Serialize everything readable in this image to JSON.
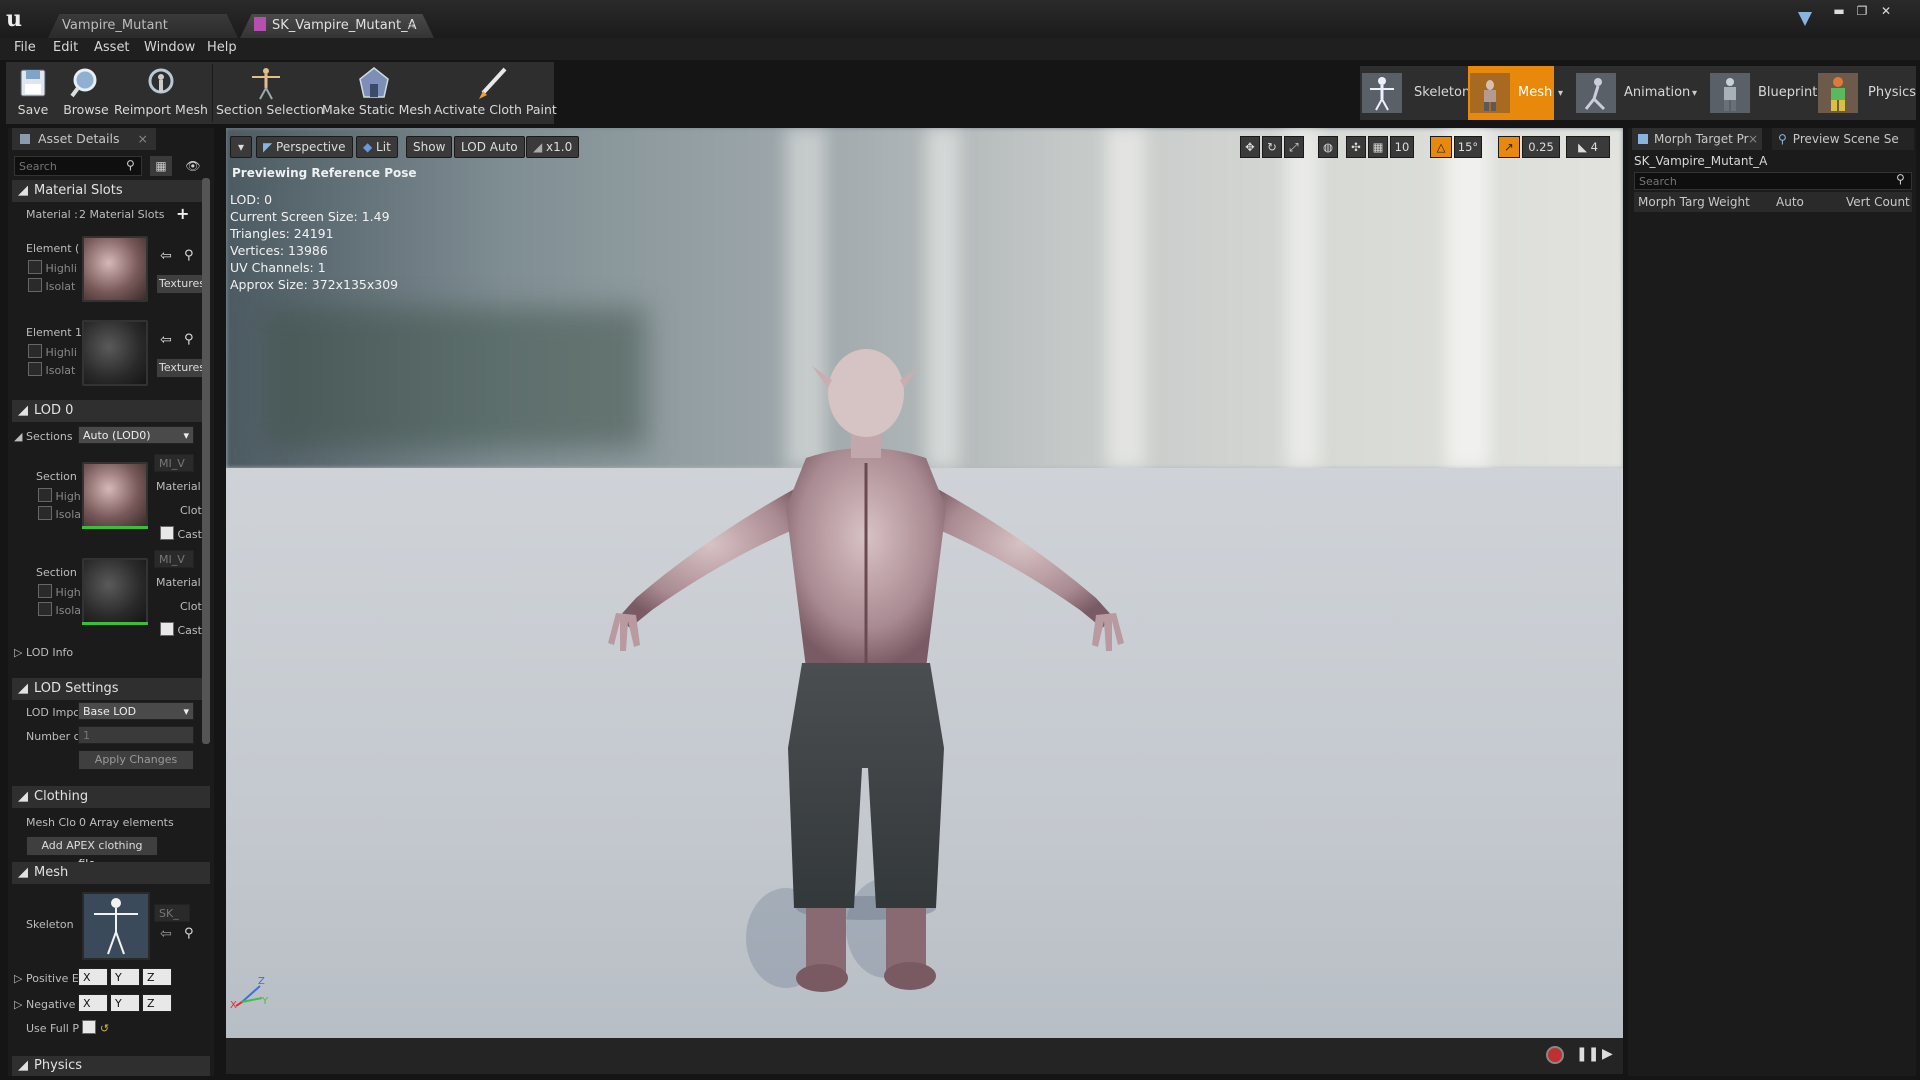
{
  "window": {
    "logo": "u",
    "tabs": [
      "Vampire_Mutant",
      "SK_Vampire_Mutant_A"
    ],
    "tab_close": "×",
    "controls": [
      "▬",
      "❐",
      "✕"
    ]
  },
  "menu": [
    "File",
    "Edit",
    "Asset",
    "Window",
    "Help"
  ],
  "toolbar": [
    {
      "label": "Save",
      "icon": "save-icon"
    },
    {
      "label": "Browse",
      "icon": "browse-icon"
    },
    {
      "label": "Reimport Mesh",
      "icon": "reimport-icon"
    },
    {
      "label": "Section Selection",
      "icon": "section-selection-icon"
    },
    {
      "label": "Make Static Mesh",
      "icon": "make-static-mesh-icon"
    },
    {
      "label": "Activate Cloth Paint",
      "icon": "cloth-paint-icon"
    }
  ],
  "modes": [
    "Skeleton",
    "Mesh",
    "Animation",
    "Blueprint",
    "Physics"
  ],
  "active_mode_color": "#e8890c",
  "left_panel": {
    "tab": "Asset Details",
    "search_placeholder": "Search",
    "material_slots": {
      "header": "Material Slots",
      "label": "Material :",
      "value": "2 Material Slots",
      "add": "+",
      "elements": [
        {
          "label": "Element (",
          "highlight": "Highli",
          "isolate": "Isolat",
          "texture_btn": "Textures"
        },
        {
          "label": "Element 1",
          "highlight": "Highli",
          "isolate": "Isolat",
          "texture_btn": "Textures"
        }
      ]
    },
    "lod0": {
      "header": "LOD 0",
      "sections_label": "Sections",
      "sections_value": "Auto (LOD0)",
      "sections": [
        {
          "label": "Section",
          "high": "High",
          "isola": "Isola",
          "material": "Material",
          "cloth": "Cloth",
          "cast": "Cast",
          "combo": "MI_V"
        },
        {
          "label": "Section",
          "high": "High",
          "isola": "Isola",
          "material": "Material",
          "cloth": "Cloth",
          "cast": "Cast",
          "combo": "MI_V"
        }
      ],
      "lod_info": "LOD Info"
    },
    "lod_settings": {
      "header": "LOD Settings",
      "lod_import_label": "LOD Impc",
      "lod_import_value": "Base LOD",
      "number_label": "Number c",
      "number_value": "1",
      "apply": "Apply Changes"
    },
    "clothing": {
      "header": "Clothing",
      "mesh_label": "Mesh Clo",
      "mesh_value": "0 Array elements",
      "add_btn": "Add APEX clothing file..."
    },
    "mesh": {
      "header": "Mesh",
      "skeleton_label": "Skeleton",
      "skeleton_combo": "SK_",
      "positive_label": "Positive E",
      "negative_label": "Negative",
      "use_full_label": "Use Full P",
      "axes": [
        "X",
        "Y",
        "Z"
      ]
    },
    "physics_header": "Physics"
  },
  "viewport": {
    "buttons": [
      "Perspective",
      "Lit",
      "Show",
      "LOD Auto",
      "x1.0"
    ],
    "snap": {
      "grid": "10",
      "angle": "15°",
      "scale": "0.25",
      "camera": "4"
    },
    "preview_text": "Previewing Reference Pose",
    "stats": [
      "LOD: 0",
      "Current Screen Size: 1.49",
      "Triangles: 24191",
      "Vertices: 13986",
      "UV Channels: 1",
      "Approx Size: 372x135x309"
    ],
    "axis": {
      "z": "Z",
      "y": "Y",
      "x": "X"
    }
  },
  "right_panel": {
    "tabs": [
      "Morph Target Pr",
      "Preview Scene Se"
    ],
    "asset_name": "SK_Vampire_Mutant_A",
    "search_placeholder": "Search",
    "columns": [
      "Morph Targ",
      "Weight",
      "Auto",
      "Vert Count"
    ]
  }
}
